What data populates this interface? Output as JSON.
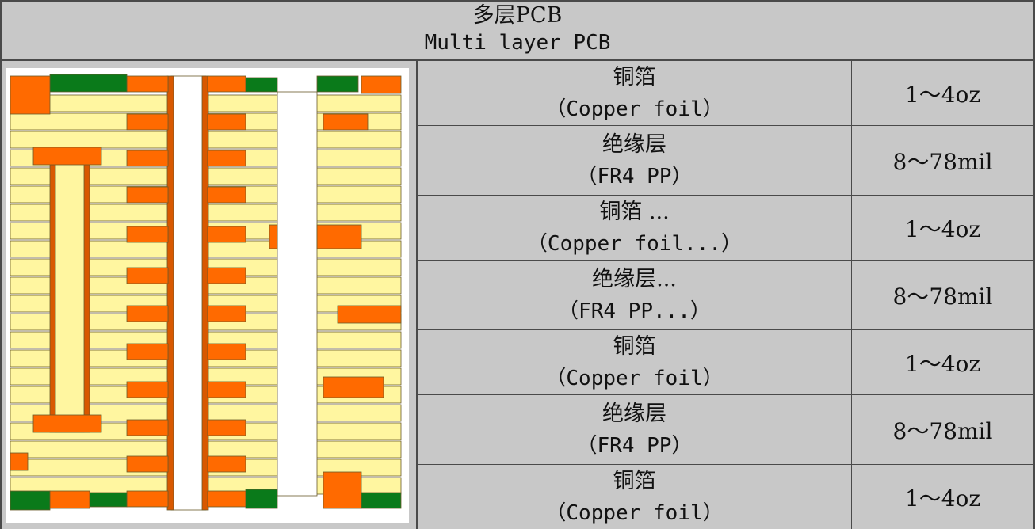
{
  "header": {
    "title_cn": "多层PCB",
    "title_en": "Multi layer PCB"
  },
  "rows": [
    {
      "name_cn": "铜箔",
      "name_en": "（Copper foil）",
      "value": "1～4oz"
    },
    {
      "name_cn": "绝缘层",
      "name_en": "（FR4 PP）",
      "value": "8～78mil"
    },
    {
      "name_cn": "铜箔 ...",
      "name_en": "（Copper foil...）",
      "value": "1～4oz"
    },
    {
      "name_cn": "绝缘层...",
      "name_en": "（FR4 PP...）",
      "value": "8～78mil"
    },
    {
      "name_cn": "铜箔",
      "name_en": "（Copper foil）",
      "value": "1～4oz"
    },
    {
      "name_cn": "绝缘层",
      "name_en": "（FR4 PP）",
      "value": "8～78mil"
    },
    {
      "name_cn": "铜箔",
      "name_en": "（Copper foil）",
      "value": "1～4oz"
    }
  ],
  "colors": {
    "background": "#c8c8c8",
    "grid_line": "#4a4a4a",
    "copper": "#ff6a00",
    "dielectric": "#fff6a0",
    "solder_mask": "#0a7a1a",
    "plating": "#d85800"
  },
  "figure": {
    "icon": "pcb-cross-section-illustration"
  }
}
